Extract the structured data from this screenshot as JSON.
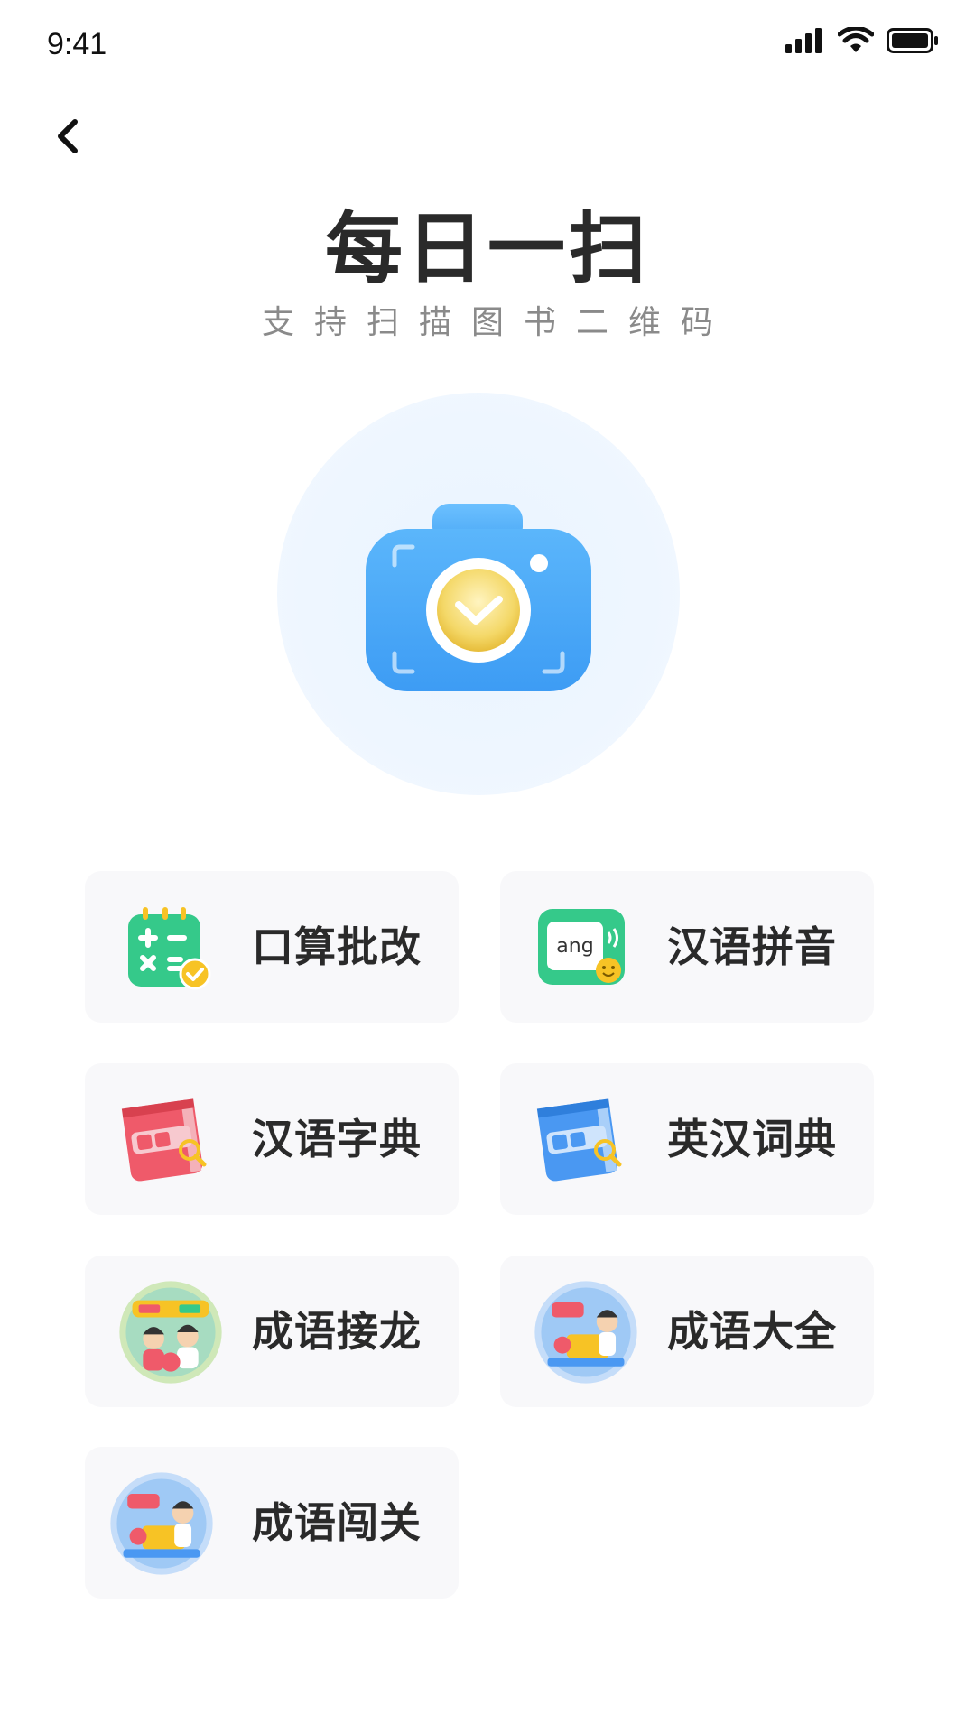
{
  "status_bar": {
    "time": "9:41"
  },
  "header": {
    "title": "每日一扫",
    "subtitle": "支持扫描图书二维码"
  },
  "scan": {
    "icon": "camera-icon"
  },
  "features": [
    {
      "label": "口算批改",
      "icon": "calculator-icon"
    },
    {
      "label": "汉语拼音",
      "icon": "pinyin-icon",
      "icon_text": "ang"
    },
    {
      "label": "汉语字典",
      "icon": "chinese-dictionary-icon"
    },
    {
      "label": "英汉词典",
      "icon": "english-dictionary-icon"
    },
    {
      "label": "成语接龙",
      "icon": "idiom-chain-icon"
    },
    {
      "label": "成语大全",
      "icon": "idiom-collection-icon"
    },
    {
      "label": "成语闯关",
      "icon": "idiom-challenge-icon"
    }
  ],
  "colors": {
    "accent_blue": "#4aa8f5",
    "green": "#35c98a",
    "red": "#ef5a6a",
    "yellow": "#f7c325",
    "tile_bg": "#f8f8fa"
  }
}
